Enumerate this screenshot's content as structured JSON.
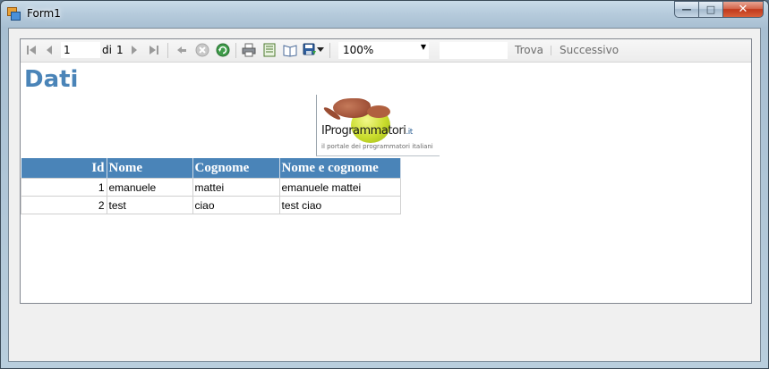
{
  "window": {
    "title": "Form1",
    "caption": {
      "minimize": "—",
      "maximize": "□",
      "close": "✕"
    }
  },
  "toolbar": {
    "page_current": "1",
    "page_of_label": "di",
    "page_total": "1",
    "zoom_value": "100%",
    "find_value": "",
    "find_label": "Trova",
    "next_label": "Successivo",
    "icons": [
      "first-page-icon",
      "previous-page-icon",
      "next-page-icon",
      "last-page-icon",
      "back-icon",
      "stop-icon",
      "refresh-icon",
      "print-icon",
      "print-layout-icon",
      "page-setup-icon",
      "export-icon",
      "export-dropdown-icon"
    ]
  },
  "report": {
    "title": "Dati",
    "logo": {
      "brand": "IProgrammatori",
      "brand_suffix": ".it",
      "tagline": "il portale dei programmatori italiani"
    },
    "table": {
      "columns": [
        "Id",
        "Nome",
        "Cognome",
        "Nome e cognome"
      ],
      "rows": [
        [
          "1",
          "emanuele",
          "mattei",
          "emanuele mattei"
        ],
        [
          "2",
          "test",
          "ciao",
          "test ciao"
        ]
      ]
    }
  },
  "colors": {
    "header_bg": "#4a84b8",
    "title": "#4a84b8"
  }
}
